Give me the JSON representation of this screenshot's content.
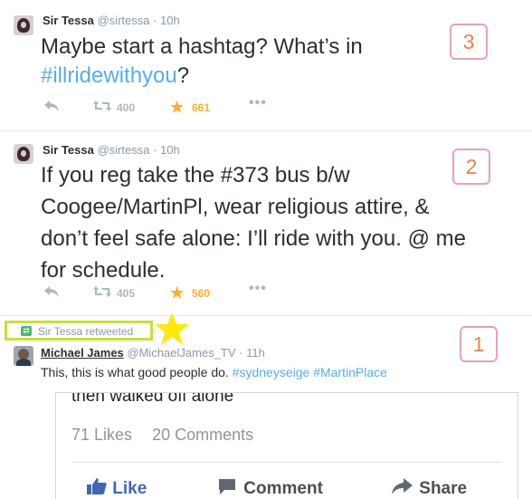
{
  "tweets": {
    "t3": {
      "name": "Sir Tessa",
      "handle": "@sirtessa",
      "time": "· 10h",
      "text_a": "Maybe start a hashtag? What’s in",
      "hashtag": "#illridewithyou",
      "text_b": "?",
      "retweets": "400",
      "favorites": "661",
      "marker": "3"
    },
    "t2": {
      "name": "Sir Tessa",
      "handle": "@sirtessa",
      "time": "· 10h",
      "lines": [
        "If you reg take the #373 bus b/w",
        "Coogee/MartinPl, wear religious attire, &",
        "don’t feel safe alone: I’ll ride with you. @ me",
        "for schedule."
      ],
      "retweets": "405",
      "favorites": "560",
      "marker": "2"
    },
    "t1": {
      "retweeted_by": "Sir Tessa retweeted",
      "name": "Michael James",
      "handle": "@MichaelJames_TV",
      "time": "· 11h",
      "text": "This, this is what good people do.",
      "hashtags": "#sydneyseige #MartinPlace",
      "marker": "1",
      "card": {
        "cut_text": "then walked off alone",
        "likes": "71 Likes",
        "comments": "20 Comments",
        "like_label": "Like",
        "comment_label": "Comment",
        "share_label": "Share"
      }
    }
  },
  "colors": {
    "link": "#55acee",
    "favorite": "#ffac33",
    "marker_border": "#e7a2b3",
    "highlight": "#c4e13b",
    "star": "#ffe810"
  },
  "icons": [
    "reply-icon",
    "retweet-icon",
    "favorite-star-icon",
    "more-dots-icon",
    "highlight-star-icon",
    "thumbs-up-icon",
    "comment-icon",
    "share-icon"
  ]
}
